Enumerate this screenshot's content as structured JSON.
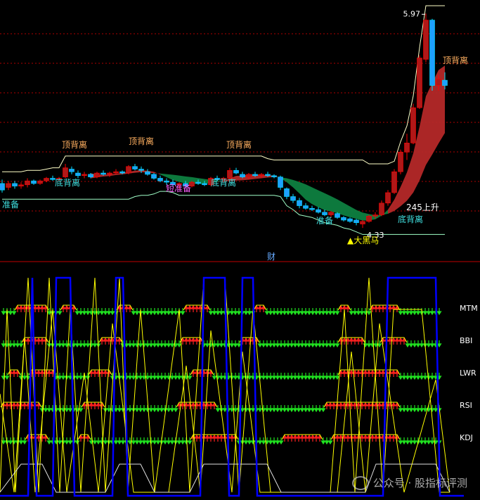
{
  "colors": {
    "background": "#000000",
    "up": "#ff0000",
    "up_body": "#b01818",
    "down": "#00e0ff",
    "down_strong": "#1ea0ff",
    "upper_band": "#ffffc8",
    "lower_band": "#a0ffc8",
    "ribbon_green": "#0e8040",
    "ribbon_red": "#b42828",
    "grid": "#b00000",
    "label_orange": "#ffb060",
    "label_cyan": "#40e0e0",
    "label_white": "#ffffff",
    "label_yellow": "#ffff00",
    "signal_up": "#ff2020",
    "signal_down": "#20e020",
    "ind_yellow": "#ffff00",
    "ind_blue": "#0000ff"
  },
  "main_chart": {
    "price_high_label": "5.97",
    "price_low_label": "4.33",
    "divider_label": "财",
    "annotations": [
      {
        "text": "顶背离",
        "style": "orange"
      },
      {
        "text": "顶背离",
        "style": "orange"
      },
      {
        "text": "顶背离",
        "style": "orange"
      },
      {
        "text": "顶背离",
        "style": "orange"
      },
      {
        "text": "底背离",
        "style": "cyan"
      },
      {
        "text": "底背离",
        "style": "cyan"
      },
      {
        "text": "底背离",
        "style": "cyan"
      },
      {
        "text": "准备",
        "style": "cyan"
      },
      {
        "text": "准备",
        "style": "cyan"
      },
      {
        "text": "短准备",
        "style": "magenta"
      },
      {
        "text": "245上升",
        "style": "white"
      },
      {
        "text": "▲大黑马",
        "style": "yellow"
      }
    ]
  },
  "indicator_panel": {
    "rows": [
      {
        "label": "MTM"
      },
      {
        "label": "BBI"
      },
      {
        "label": "LWR"
      },
      {
        "label": "RSI"
      },
      {
        "label": "KDJ"
      }
    ]
  },
  "watermark": "公众号 · 股指标评测",
  "chart_data": {
    "type": "candlestick",
    "candles": [
      {
        "o": 4.67,
        "h": 4.7,
        "l": 4.6,
        "c": 4.62
      },
      {
        "o": 4.64,
        "h": 4.69,
        "l": 4.62,
        "c": 4.67
      },
      {
        "o": 4.67,
        "h": 4.69,
        "l": 4.63,
        "c": 4.65
      },
      {
        "o": 4.65,
        "h": 4.68,
        "l": 4.63,
        "c": 4.66
      },
      {
        "o": 4.66,
        "h": 4.71,
        "l": 4.64,
        "c": 4.69
      },
      {
        "o": 4.69,
        "h": 4.7,
        "l": 4.66,
        "c": 4.67
      },
      {
        "o": 4.67,
        "h": 4.7,
        "l": 4.66,
        "c": 4.69
      },
      {
        "o": 4.69,
        "h": 4.72,
        "l": 4.68,
        "c": 4.71
      },
      {
        "o": 4.71,
        "h": 4.73,
        "l": 4.69,
        "c": 4.7
      },
      {
        "o": 4.7,
        "h": 4.72,
        "l": 4.69,
        "c": 4.71
      },
      {
        "o": 4.72,
        "h": 4.82,
        "l": 4.71,
        "c": 4.79
      },
      {
        "o": 4.78,
        "h": 4.8,
        "l": 4.74,
        "c": 4.76
      },
      {
        "o": 4.75,
        "h": 4.77,
        "l": 4.71,
        "c": 4.73
      },
      {
        "o": 4.73,
        "h": 4.76,
        "l": 4.71,
        "c": 4.74
      },
      {
        "o": 4.74,
        "h": 4.75,
        "l": 4.71,
        "c": 4.72
      },
      {
        "o": 4.72,
        "h": 4.76,
        "l": 4.71,
        "c": 4.75
      },
      {
        "o": 4.75,
        "h": 4.77,
        "l": 4.73,
        "c": 4.74
      },
      {
        "o": 4.74,
        "h": 4.76,
        "l": 4.72,
        "c": 4.75
      },
      {
        "o": 4.75,
        "h": 4.78,
        "l": 4.74,
        "c": 4.76
      },
      {
        "o": 4.76,
        "h": 4.77,
        "l": 4.74,
        "c": 4.75
      },
      {
        "o": 4.75,
        "h": 4.81,
        "l": 4.74,
        "c": 4.8
      },
      {
        "o": 4.8,
        "h": 4.82,
        "l": 4.77,
        "c": 4.78
      },
      {
        "o": 4.78,
        "h": 4.8,
        "l": 4.75,
        "c": 4.77
      },
      {
        "o": 4.76,
        "h": 4.78,
        "l": 4.73,
        "c": 4.74
      },
      {
        "o": 4.74,
        "h": 4.75,
        "l": 4.7,
        "c": 4.71
      },
      {
        "o": 4.71,
        "h": 4.73,
        "l": 4.68,
        "c": 4.69
      },
      {
        "o": 4.69,
        "h": 4.71,
        "l": 4.66,
        "c": 4.68
      },
      {
        "o": 4.68,
        "h": 4.7,
        "l": 4.65,
        "c": 4.66
      },
      {
        "o": 4.66,
        "h": 4.68,
        "l": 4.63,
        "c": 4.67
      },
      {
        "o": 4.67,
        "h": 4.69,
        "l": 4.64,
        "c": 4.65
      },
      {
        "o": 4.65,
        "h": 4.69,
        "l": 4.64,
        "c": 4.68
      },
      {
        "o": 4.68,
        "h": 4.7,
        "l": 4.66,
        "c": 4.67
      },
      {
        "o": 4.67,
        "h": 4.69,
        "l": 4.65,
        "c": 4.66
      },
      {
        "o": 4.66,
        "h": 4.72,
        "l": 4.65,
        "c": 4.71
      },
      {
        "o": 4.71,
        "h": 4.73,
        "l": 4.69,
        "c": 4.7
      },
      {
        "o": 4.7,
        "h": 4.72,
        "l": 4.68,
        "c": 4.71
      },
      {
        "o": 4.71,
        "h": 4.79,
        "l": 4.7,
        "c": 4.77
      },
      {
        "o": 4.77,
        "h": 4.79,
        "l": 4.74,
        "c": 4.75
      },
      {
        "o": 4.74,
        "h": 4.76,
        "l": 4.71,
        "c": 4.72
      },
      {
        "o": 4.72,
        "h": 4.75,
        "l": 4.7,
        "c": 4.74
      },
      {
        "o": 4.74,
        "h": 4.76,
        "l": 4.72,
        "c": 4.73
      },
      {
        "o": 4.73,
        "h": 4.75,
        "l": 4.71,
        "c": 4.74
      },
      {
        "o": 4.74,
        "h": 4.76,
        "l": 4.72,
        "c": 4.73
      },
      {
        "o": 4.73,
        "h": 4.74,
        "l": 4.71,
        "c": 4.72
      },
      {
        "o": 4.72,
        "h": 4.73,
        "l": 4.62,
        "c": 4.64
      },
      {
        "o": 4.63,
        "h": 4.64,
        "l": 4.55,
        "c": 4.57
      },
      {
        "o": 4.57,
        "h": 4.59,
        "l": 4.52,
        "c": 4.54
      },
      {
        "o": 4.54,
        "h": 4.56,
        "l": 4.48,
        "c": 4.5
      },
      {
        "o": 4.5,
        "h": 4.52,
        "l": 4.47,
        "c": 4.48
      },
      {
        "o": 4.48,
        "h": 4.5,
        "l": 4.46,
        "c": 4.47
      },
      {
        "o": 4.47,
        "h": 4.49,
        "l": 4.44,
        "c": 4.45
      },
      {
        "o": 4.45,
        "h": 4.47,
        "l": 4.42,
        "c": 4.43
      },
      {
        "o": 4.43,
        "h": 4.46,
        "l": 4.41,
        "c": 4.45
      },
      {
        "o": 4.44,
        "h": 4.45,
        "l": 4.4,
        "c": 4.41
      },
      {
        "o": 4.41,
        "h": 4.42,
        "l": 4.38,
        "c": 4.39
      },
      {
        "o": 4.4,
        "h": 4.41,
        "l": 4.37,
        "c": 4.38
      },
      {
        "o": 4.39,
        "h": 4.4,
        "l": 4.35,
        "c": 4.37
      },
      {
        "o": 4.36,
        "h": 4.39,
        "l": 4.33,
        "c": 4.38
      },
      {
        "o": 4.38,
        "h": 4.43,
        "l": 4.37,
        "c": 4.42
      },
      {
        "o": 4.42,
        "h": 4.45,
        "l": 4.4,
        "c": 4.43
      },
      {
        "o": 4.43,
        "h": 4.54,
        "l": 4.42,
        "c": 4.52
      },
      {
        "o": 4.52,
        "h": 4.62,
        "l": 4.5,
        "c": 4.6
      },
      {
        "o": 4.6,
        "h": 4.78,
        "l": 4.59,
        "c": 4.76
      },
      {
        "o": 4.76,
        "h": 4.93,
        "l": 4.74,
        "c": 4.91
      },
      {
        "o": 4.91,
        "h": 5.05,
        "l": 4.85,
        "c": 4.98
      },
      {
        "o": 4.98,
        "h": 5.28,
        "l": 4.97,
        "c": 5.25
      },
      {
        "o": 5.25,
        "h": 5.65,
        "l": 5.24,
        "c": 5.63
      },
      {
        "o": 5.62,
        "h": 5.97,
        "l": 5.6,
        "c": 5.92
      },
      {
        "o": 5.92,
        "h": 5.93,
        "l": 5.38,
        "c": 5.42
      },
      {
        "o": 5.42,
        "h": 5.5,
        "l": 5.38,
        "c": 5.47
      },
      {
        "o": 5.46,
        "h": 5.52,
        "l": 5.39,
        "c": 5.42
      }
    ]
  }
}
